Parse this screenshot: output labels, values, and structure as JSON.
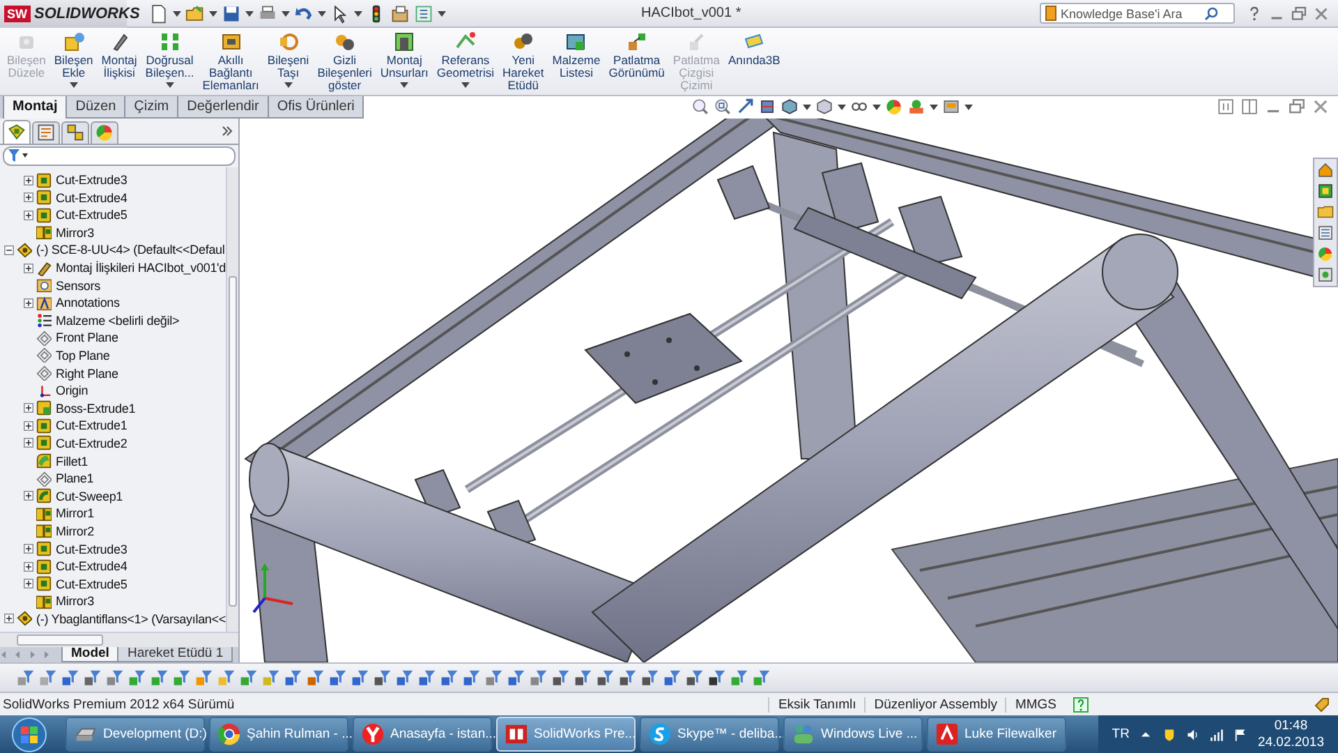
{
  "title_bar": {
    "logo": {
      "mark": "SW",
      "text": "SOLIDWORKS"
    },
    "title": "HACIbot_v001 *",
    "search": {
      "placeholder": "Knowledge Base'i Ara"
    }
  },
  "ribbon": {
    "commands": [
      {
        "label": "Bileşen\nDüzele",
        "kind": "fix",
        "disabled": true,
        "dropdown": false
      },
      {
        "label": "Bileşen\nEkle",
        "kind": "insert",
        "disabled": false,
        "dropdown": true
      },
      {
        "label": "Montaj\nİlişkisi",
        "kind": "mate",
        "disabled": false,
        "dropdown": false
      },
      {
        "label": "Doğrusal\nBileşen...",
        "kind": "pattern",
        "disabled": false,
        "dropdown": true
      },
      {
        "label": "Akıllı\nBağlantı\nElemanları",
        "kind": "fastener",
        "disabled": false,
        "dropdown": false
      },
      {
        "label": "Bileşeni\nTaşı",
        "kind": "move",
        "disabled": false,
        "dropdown": true
      },
      {
        "label": "Gizli\nBileşenleri\ngöster",
        "kind": "show",
        "disabled": false,
        "dropdown": false
      },
      {
        "label": "Montaj\nUnsurları",
        "kind": "feature",
        "disabled": false,
        "dropdown": true
      },
      {
        "label": "Referans\nGeometrisi",
        "kind": "reference",
        "disabled": false,
        "dropdown": true
      },
      {
        "label": "Yeni\nHareket\nEtüdü",
        "kind": "motion",
        "disabled": false,
        "dropdown": false
      },
      {
        "label": "Malzeme\nListesi",
        "kind": "bom",
        "disabled": false,
        "dropdown": false
      },
      {
        "label": "Patlatma\nGörünümü",
        "kind": "explode",
        "disabled": false,
        "dropdown": false
      },
      {
        "label": "Patlatma\nÇizgisi\nÇizimi",
        "kind": "explode_line",
        "disabled": true,
        "dropdown": false
      },
      {
        "label": "Anında3B",
        "kind": "instant3d",
        "disabled": false,
        "dropdown": false
      }
    ],
    "tabs": [
      {
        "label": "Montaj",
        "selected": true
      },
      {
        "label": "Düzen",
        "selected": false
      },
      {
        "label": "Çizim",
        "selected": false
      },
      {
        "label": "Değerlendir",
        "selected": false
      },
      {
        "label": "Ofis Ürünleri",
        "selected": false
      }
    ]
  },
  "feature_manager": {
    "panel_tabs": [
      {
        "kind": "tree",
        "selected": true
      },
      {
        "kind": "property",
        "selected": false
      },
      {
        "kind": "config",
        "selected": false
      },
      {
        "kind": "appearance",
        "selected": false
      }
    ],
    "tree": {
      "continued_items": [
        {
          "label": "Cut-Extrude3",
          "kind": "extrude",
          "expanded": false
        },
        {
          "label": "Cut-Extrude4",
          "kind": "extrude",
          "expanded": false
        },
        {
          "label": "Cut-Extrude5",
          "kind": "extrude",
          "expanded": false
        },
        {
          "label": "Mirror3",
          "kind": "mirror"
        }
      ],
      "items": [
        {
          "label": "(-) SCE-8-UU<4> (Default<<Defaul",
          "kind": "part",
          "expanded": true,
          "children": [
            {
              "label": "Montaj İlişkileri HACIbot_v001'd",
              "kind": "mates",
              "expanded": false
            },
            {
              "label": "Sensors",
              "kind": "sensors"
            },
            {
              "label": "Annotations",
              "kind": "annotations",
              "expanded": false
            },
            {
              "label": "Malzeme <belirli değil>",
              "kind": "material"
            },
            {
              "label": "Front Plane",
              "kind": "plane"
            },
            {
              "label": "Top Plane",
              "kind": "plane"
            },
            {
              "label": "Right Plane",
              "kind": "plane"
            },
            {
              "label": "Origin",
              "kind": "origin"
            },
            {
              "label": "Boss-Extrude1",
              "kind": "boss",
              "expanded": false
            },
            {
              "label": "Cut-Extrude1",
              "kind": "extrude",
              "expanded": false
            },
            {
              "label": "Cut-Extrude2",
              "kind": "extrude",
              "expanded": false
            },
            {
              "label": "Fillet1",
              "kind": "fillet"
            },
            {
              "label": "Plane1",
              "kind": "plane"
            },
            {
              "label": "Cut-Sweep1",
              "kind": "sweep",
              "expanded": false
            },
            {
              "label": "Mirror1",
              "kind": "mirror"
            },
            {
              "label": "Mirror2",
              "kind": "mirror"
            },
            {
              "label": "Cut-Extrude3",
              "kind": "extrude",
              "expanded": false
            },
            {
              "label": "Cut-Extrude4",
              "kind": "extrude",
              "expanded": false
            },
            {
              "label": "Cut-Extrude5",
              "kind": "extrude",
              "expanded": false
            },
            {
              "label": "Mirror3",
              "kind": "mirror"
            }
          ]
        },
        {
          "label": "(-) Ybaglantiflans<1> (Varsayılan<<",
          "kind": "part",
          "expanded": false
        }
      ]
    },
    "bottom_tabs": [
      {
        "label": "Model",
        "selected": true
      },
      {
        "label": "Hareket Etüdü 1",
        "selected": false
      }
    ]
  },
  "status_bar": {
    "edition": "SolidWorks Premium 2012 x64 Sürümü",
    "fields": [
      "Eksik Tanımlı",
      "Düzenliyor Assembly",
      "MMGS"
    ]
  },
  "taskbar": {
    "tasks": [
      {
        "label": "Development (D:)",
        "kind": "drive",
        "selected": false
      },
      {
        "label": "Şahin Rulman - ...",
        "kind": "browser",
        "selected": false
      },
      {
        "label": "Anasayfa - istan...",
        "kind": "browser_y",
        "selected": false
      },
      {
        "label": "SolidWorks Pre...",
        "kind": "cad",
        "selected": true
      },
      {
        "label": "Skype™ - deliba...",
        "kind": "chat",
        "selected": false
      },
      {
        "label": "Windows Live ...",
        "kind": "messenger",
        "selected": false
      },
      {
        "label": "Luke Filewalker",
        "kind": "antivirus",
        "selected": false
      }
    ],
    "language": "TR",
    "time": "01:48",
    "date": "24.02.2013"
  }
}
